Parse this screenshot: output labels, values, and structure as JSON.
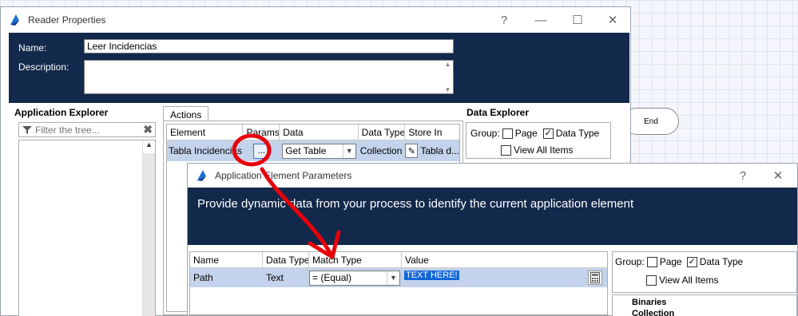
{
  "reader_dialog": {
    "title": "Reader Properties",
    "name_label": "Name:",
    "name_value": "Leer Incidencias",
    "description_label": "Description:",
    "description_value": ""
  },
  "app_explorer": {
    "title": "Application Explorer",
    "filter_placeholder": "Filter the tree..."
  },
  "actions": {
    "tab_label": "Actions",
    "columns": [
      "Element",
      "Params",
      "Data",
      "Data Type",
      "Store In"
    ],
    "row": {
      "element": "Tabla Incidencias",
      "params_button": "...",
      "data": "Get Table",
      "data_type": "Collection",
      "store_in": "Tabla d..."
    }
  },
  "data_explorer": {
    "title": "Data Explorer",
    "group_label": "Group:",
    "page_label": "Page",
    "datatype_label": "Data Type",
    "view_all_label": "View All Items"
  },
  "end_stage": {
    "label": "End"
  },
  "param_dialog": {
    "title": "Application Element Parameters",
    "header_text": "Provide dynamic data from your process to identify the current application element",
    "columns": [
      "Name",
      "Data Type",
      "Match Type",
      "Value"
    ],
    "row": {
      "name": "Path",
      "data_type": "Text",
      "match_type": "=  (Equal)",
      "value": "TEXT HERE!"
    },
    "group_label": "Group:",
    "page_label": "Page",
    "datatype_label": "Data Type",
    "view_all_label": "View All Items",
    "tree_items": [
      "Binaries",
      "Collection"
    ]
  },
  "window_controls": {
    "help": "?",
    "minimize": "—",
    "maximize": "☐",
    "close": "✕"
  },
  "colors": {
    "navy": "#13294b",
    "selection": "#c4d3ec",
    "annotation": "#e8000b"
  }
}
